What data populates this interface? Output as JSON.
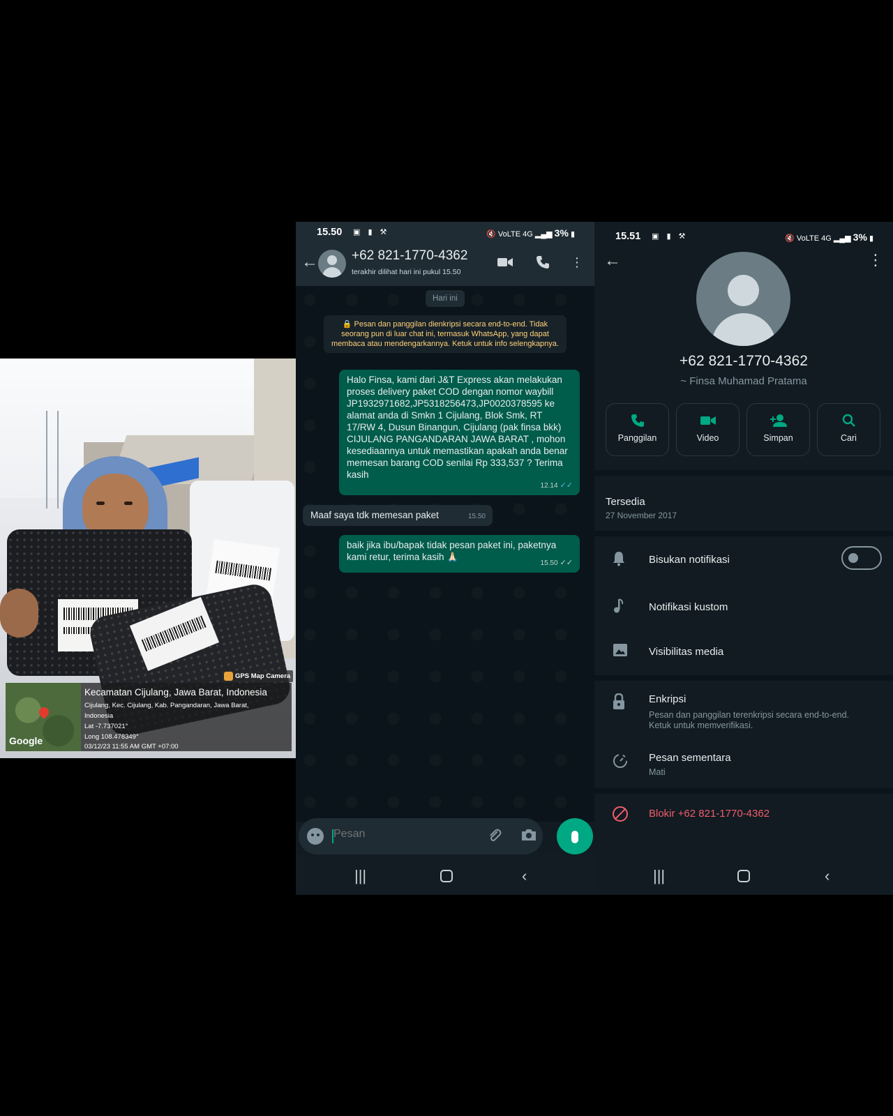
{
  "photo": {
    "gps_tag": "GPS Map Camera",
    "map_label": "Google",
    "location_title": "Kecamatan Cijulang, Jawa Barat, Indonesia",
    "address_line1": "Cijulang, Kec. Cijulang, Kab. Pangandaran, Jawa Barat,",
    "address_line2": "Indonesia",
    "lat": "Lat -7.737021°",
    "long": "Long 108.478349°",
    "datetime": "03/12/23 11:55 AM GMT +07:00"
  },
  "chat": {
    "status_time": "15.50",
    "battery": "3%",
    "contact_number": "+62 821-1770-4362",
    "last_seen": "terakhir dilihat hari ini pukul 15.50",
    "date_chip": "Hari ini",
    "encryption_notice": "🔒 Pesan dan panggilan dienkripsi secara end-to-end. Tidak seorang pun di luar chat ini, termasuk WhatsApp, yang dapat membaca atau mendengarkannya. Ketuk untuk info selengkapnya.",
    "messages": [
      {
        "text": "Halo Finsa, kami dari J&T Express akan melakukan proses delivery paket COD dengan nomor waybill JP1932971682,JP5318256473,JP0020378595 ke alamat anda di Smkn 1 Cijulang, Blok Smk, RT 17/RW 4, Dusun Binangun, Cijulang (pak finsa bkk) CIJULANG PANGANDARAN JAWA BARAT , mohon kesediaannya untuk memastikan apakah anda benar memesan barang COD senilai Rp 333,537 ? Terima kasih",
        "time": "12.14"
      },
      {
        "text": "Maaf saya tdk memesan paket",
        "time": "15.50"
      },
      {
        "text": "baik jika ibu/bapak tidak pesan paket ini, paketnya kami retur, terima kasih 🙏🏻",
        "time": "15.50"
      }
    ],
    "composer_placeholder": "Pesan"
  },
  "info": {
    "status_time": "15.51",
    "battery": "3%",
    "number": "+62 821-1770-4362",
    "alias": "~ Finsa Muhamad Pratama",
    "actions": [
      "Panggilan",
      "Video",
      "Simpan",
      "Cari"
    ],
    "about_title": "Tersedia",
    "about_date": "27 November 2017",
    "mute_label": "Bisukan notifikasi",
    "custom_notif_label": "Notifikasi kustom",
    "media_visibility_label": "Visibilitas media",
    "encryption_title": "Enkripsi",
    "encryption_desc": "Pesan dan panggilan terenkripsi secara end-to-end. Ketuk untuk memverifikasi.",
    "disappearing_title": "Pesan sementara",
    "disappearing_value": "Mati",
    "block_label": "Blokir +62 821-1770-4362"
  },
  "colors": {
    "accent": "#00a884",
    "outgoing_bubble": "#005c4b",
    "incoming_bubble": "#1f2c34",
    "danger": "#f15c6d",
    "encryption_text": "#ffd279"
  }
}
